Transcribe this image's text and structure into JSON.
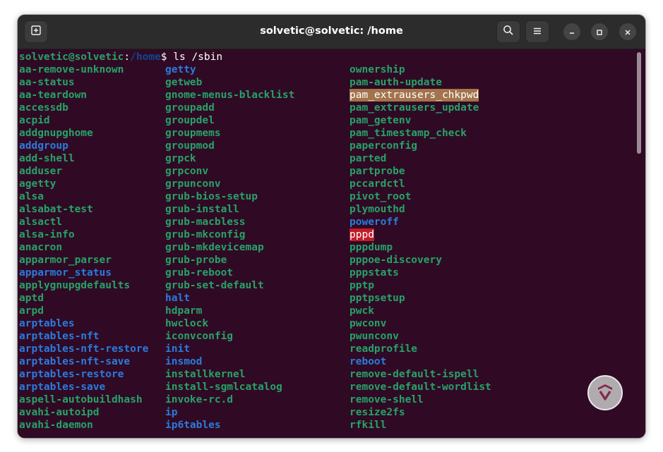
{
  "window": {
    "title": "solvetic@solvetic: /home",
    "icons": {
      "new_tab": "new-tab-icon",
      "search": "search-icon",
      "menu": "hamburger-menu-icon",
      "minimize": "minimize-icon",
      "maximize": "maximize-icon",
      "close": "close-icon"
    }
  },
  "terminal": {
    "prompt_user": "solvetic@solvetic",
    "prompt_sep": ":",
    "prompt_path": "/home",
    "prompt_command": "$ ls /sbin",
    "colors": {
      "background": "#300a24",
      "prompt_user": "#26a269",
      "prompt_path": "#12488b",
      "executable": "#26a269",
      "symlink": "#2a7bde",
      "setuid_bg": "#a2734c",
      "setuid_fg": "#ffffff",
      "setgid_bg": "#c01c28",
      "setgid_fg": "#ffffff"
    },
    "columns": [
      [
        {
          "name": "aa-remove-unknown",
          "type": "exec"
        },
        {
          "name": "aa-status",
          "type": "exec"
        },
        {
          "name": "aa-teardown",
          "type": "exec"
        },
        {
          "name": "accessdb",
          "type": "exec"
        },
        {
          "name": "acpid",
          "type": "exec"
        },
        {
          "name": "addgnupghome",
          "type": "exec"
        },
        {
          "name": "addgroup",
          "type": "link"
        },
        {
          "name": "add-shell",
          "type": "exec"
        },
        {
          "name": "adduser",
          "type": "exec"
        },
        {
          "name": "agetty",
          "type": "exec"
        },
        {
          "name": "alsa",
          "type": "exec"
        },
        {
          "name": "alsabat-test",
          "type": "exec"
        },
        {
          "name": "alsactl",
          "type": "exec"
        },
        {
          "name": "alsa-info",
          "type": "exec"
        },
        {
          "name": "anacron",
          "type": "exec"
        },
        {
          "name": "apparmor_parser",
          "type": "exec"
        },
        {
          "name": "apparmor_status",
          "type": "link"
        },
        {
          "name": "applygnupgdefaults",
          "type": "exec"
        },
        {
          "name": "aptd",
          "type": "exec"
        },
        {
          "name": "arpd",
          "type": "exec"
        },
        {
          "name": "arptables",
          "type": "link"
        },
        {
          "name": "arptables-nft",
          "type": "link"
        },
        {
          "name": "arptables-nft-restore",
          "type": "link"
        },
        {
          "name": "arptables-nft-save",
          "type": "link"
        },
        {
          "name": "arptables-restore",
          "type": "link"
        },
        {
          "name": "arptables-save",
          "type": "link"
        },
        {
          "name": "aspell-autobuildhash",
          "type": "exec"
        },
        {
          "name": "avahi-autoipd",
          "type": "exec"
        },
        {
          "name": "avahi-daemon",
          "type": "exec"
        }
      ],
      [
        {
          "name": "getty",
          "type": "link"
        },
        {
          "name": "getweb",
          "type": "exec"
        },
        {
          "name": "gnome-menus-blacklist",
          "type": "exec"
        },
        {
          "name": "groupadd",
          "type": "exec"
        },
        {
          "name": "groupdel",
          "type": "exec"
        },
        {
          "name": "groupmems",
          "type": "exec"
        },
        {
          "name": "groupmod",
          "type": "exec"
        },
        {
          "name": "grpck",
          "type": "exec"
        },
        {
          "name": "grpconv",
          "type": "exec"
        },
        {
          "name": "grpunconv",
          "type": "exec"
        },
        {
          "name": "grub-bios-setup",
          "type": "exec"
        },
        {
          "name": "grub-install",
          "type": "exec"
        },
        {
          "name": "grub-macbless",
          "type": "exec"
        },
        {
          "name": "grub-mkconfig",
          "type": "exec"
        },
        {
          "name": "grub-mkdevicemap",
          "type": "exec"
        },
        {
          "name": "grub-probe",
          "type": "exec"
        },
        {
          "name": "grub-reboot",
          "type": "exec"
        },
        {
          "name": "grub-set-default",
          "type": "exec"
        },
        {
          "name": "halt",
          "type": "link"
        },
        {
          "name": "hdparm",
          "type": "exec"
        },
        {
          "name": "hwclock",
          "type": "exec"
        },
        {
          "name": "iconvconfig",
          "type": "exec"
        },
        {
          "name": "init",
          "type": "link"
        },
        {
          "name": "insmod",
          "type": "link"
        },
        {
          "name": "installkernel",
          "type": "exec"
        },
        {
          "name": "install-sgmlcatalog",
          "type": "exec"
        },
        {
          "name": "invoke-rc.d",
          "type": "exec"
        },
        {
          "name": "ip",
          "type": "link"
        },
        {
          "name": "ip6tables",
          "type": "link"
        }
      ],
      [
        {
          "name": "ownership",
          "type": "exec"
        },
        {
          "name": "pam-auth-update",
          "type": "exec"
        },
        {
          "name": "pam_extrausers_chkpwd",
          "type": "setuid"
        },
        {
          "name": "pam_extrausers_update",
          "type": "exec"
        },
        {
          "name": "pam_getenv",
          "type": "exec"
        },
        {
          "name": "pam_timestamp_check",
          "type": "exec"
        },
        {
          "name": "paperconfig",
          "type": "exec"
        },
        {
          "name": "parted",
          "type": "exec"
        },
        {
          "name": "partprobe",
          "type": "exec"
        },
        {
          "name": "pccardctl",
          "type": "exec"
        },
        {
          "name": "pivot_root",
          "type": "exec"
        },
        {
          "name": "plymouthd",
          "type": "exec"
        },
        {
          "name": "poweroff",
          "type": "link"
        },
        {
          "name": "pppd",
          "type": "setgid"
        },
        {
          "name": "pppdump",
          "type": "exec"
        },
        {
          "name": "pppoe-discovery",
          "type": "exec"
        },
        {
          "name": "pppstats",
          "type": "exec"
        },
        {
          "name": "pptp",
          "type": "exec"
        },
        {
          "name": "pptpsetup",
          "type": "exec"
        },
        {
          "name": "pwck",
          "type": "exec"
        },
        {
          "name": "pwconv",
          "type": "exec"
        },
        {
          "name": "pwunconv",
          "type": "exec"
        },
        {
          "name": "readprofile",
          "type": "exec"
        },
        {
          "name": "reboot",
          "type": "link"
        },
        {
          "name": "remove-default-ispell",
          "type": "exec"
        },
        {
          "name": "remove-default-wordlist",
          "type": "exec"
        },
        {
          "name": "remove-shell",
          "type": "exec"
        },
        {
          "name": "resize2fs",
          "type": "exec"
        },
        {
          "name": "rfkill",
          "type": "exec"
        }
      ]
    ]
  },
  "watermark": {
    "icon": "solvetic-logo-icon"
  }
}
